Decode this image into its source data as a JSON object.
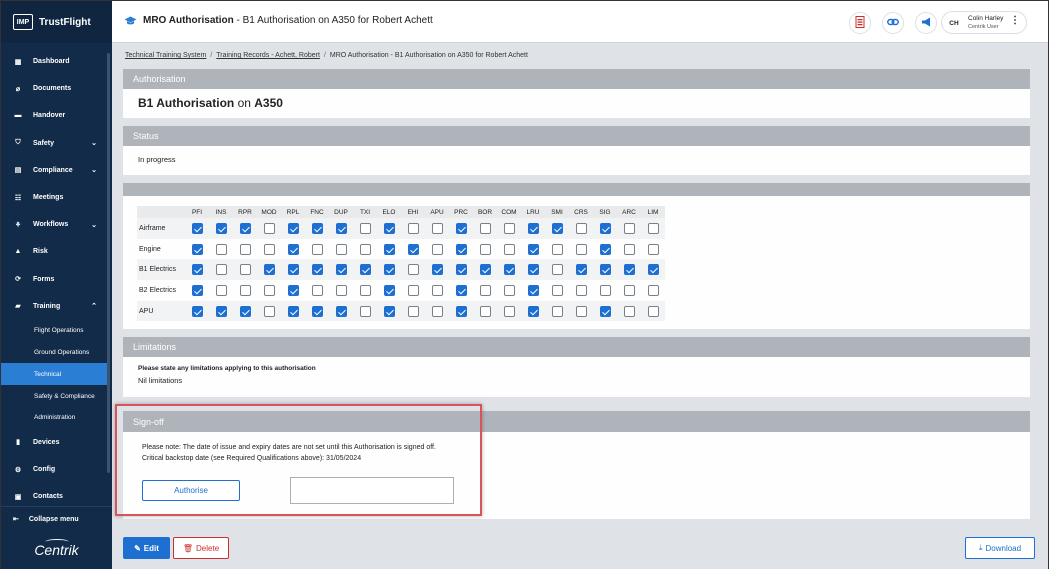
{
  "app": {
    "brand": "TrustFlight",
    "logo_text": "IMP",
    "bottom_logo": "Centrik"
  },
  "sidebar": {
    "items": [
      {
        "label": "Dashboard",
        "icon": "dashboard-icon",
        "glyph": "▦"
      },
      {
        "label": "Documents",
        "icon": "paperclip-icon",
        "glyph": "⌀"
      },
      {
        "label": "Handover",
        "icon": "handover-icon",
        "glyph": "▬"
      },
      {
        "label": "Safety",
        "icon": "shield-icon",
        "glyph": "⛉",
        "chevron": "⌄"
      },
      {
        "label": "Compliance",
        "icon": "compliance-icon",
        "glyph": "▤",
        "chevron": "⌄"
      },
      {
        "label": "Meetings",
        "icon": "meetings-icon",
        "glyph": "☷"
      },
      {
        "label": "Workflows",
        "icon": "workflows-icon",
        "glyph": "⚘",
        "chevron": "⌄"
      },
      {
        "label": "Risk",
        "icon": "risk-icon",
        "glyph": "▲"
      },
      {
        "label": "Forms",
        "icon": "forms-icon",
        "glyph": "⟳"
      },
      {
        "label": "Training",
        "icon": "graduation-cap-icon",
        "glyph": "▰",
        "chevron": "⌃"
      }
    ],
    "training_sub": [
      {
        "label": "Flight Operations"
      },
      {
        "label": "Ground Operations"
      },
      {
        "label": "Technical",
        "active": true
      },
      {
        "label": "Safety & Compliance"
      },
      {
        "label": "Administration"
      }
    ],
    "items_after": [
      {
        "label": "Devices",
        "icon": "devices-icon",
        "glyph": "▮"
      },
      {
        "label": "Config",
        "icon": "gear-icon",
        "glyph": "⚙"
      },
      {
        "label": "Contacts",
        "icon": "contacts-icon",
        "glyph": "▣"
      }
    ],
    "collapse_label": "Collapse menu"
  },
  "topbar": {
    "title_bold": "MRO Authorisation",
    "title_rest": " - B1 Authorisation on A350 for Robert Achett",
    "user_initials": "CH",
    "user_name": "Colin Harley",
    "user_role": "Centrik User"
  },
  "breadcrumb": [
    {
      "label": "Technical Training System",
      "link": true
    },
    {
      "label": "Training Records - Achett, Robert",
      "link": true
    },
    {
      "label": "MRO Authorisation - B1 Authorisation on A350 for Robert Achett",
      "link": false
    }
  ],
  "authorisation": {
    "header": "Authorisation",
    "title_bold": "B1 Authorisation",
    "title_mid": " on ",
    "title_bold2": "A350"
  },
  "status": {
    "header": "Status",
    "value": "In progress"
  },
  "matrix": {
    "columns": [
      "PFI",
      "INS",
      "RPR",
      "MOD",
      "RPL",
      "FNC",
      "DUP",
      "TXI",
      "ELO",
      "EHI",
      "APU",
      "PRC",
      "BOR",
      "COM",
      "LRU",
      "SMI",
      "CRS",
      "SIG",
      "ARC",
      "LIM"
    ],
    "rows": [
      {
        "label": "Airframe",
        "checks": [
          1,
          1,
          1,
          0,
          1,
          1,
          1,
          0,
          1,
          0,
          0,
          1,
          0,
          0,
          1,
          1,
          0,
          1,
          0,
          0
        ]
      },
      {
        "label": "Engine",
        "checks": [
          1,
          0,
          0,
          0,
          1,
          0,
          0,
          0,
          1,
          1,
          0,
          1,
          0,
          0,
          1,
          0,
          0,
          1,
          0,
          0
        ]
      },
      {
        "label": "B1 Electrics",
        "checks": [
          1,
          0,
          0,
          1,
          1,
          1,
          1,
          1,
          1,
          0,
          1,
          1,
          1,
          1,
          1,
          0,
          1,
          1,
          1,
          1
        ]
      },
      {
        "label": "B2 Electrics",
        "checks": [
          1,
          0,
          0,
          0,
          1,
          0,
          0,
          0,
          1,
          0,
          0,
          1,
          0,
          0,
          1,
          0,
          0,
          0,
          0,
          0
        ]
      },
      {
        "label": "APU",
        "checks": [
          1,
          1,
          1,
          0,
          1,
          1,
          1,
          0,
          1,
          0,
          0,
          1,
          0,
          0,
          1,
          0,
          0,
          1,
          0,
          0
        ]
      }
    ]
  },
  "limitations": {
    "header": "Limitations",
    "question": "Please state any limitations applying to this authorisation",
    "value": "Nil limitations"
  },
  "signoff": {
    "header": "Sign-off",
    "note": "Please note: The date of issue and expiry dates are not set until this Authorisation is signed off.",
    "backstop_label": "Critical backstop date (see Required Qualifications above): ",
    "backstop_date": "31/05/2024",
    "authorise_label": "Authorise",
    "signature_value": ""
  },
  "actions": {
    "edit_label": "Edit",
    "delete_label": "Delete",
    "download_label": "Download"
  },
  "colors": {
    "sidebar": "#122b49",
    "accent": "#1d6fd1",
    "panel_header": "#aeb4ba",
    "delete": "#c9302c",
    "highlight": "#d9535a"
  }
}
